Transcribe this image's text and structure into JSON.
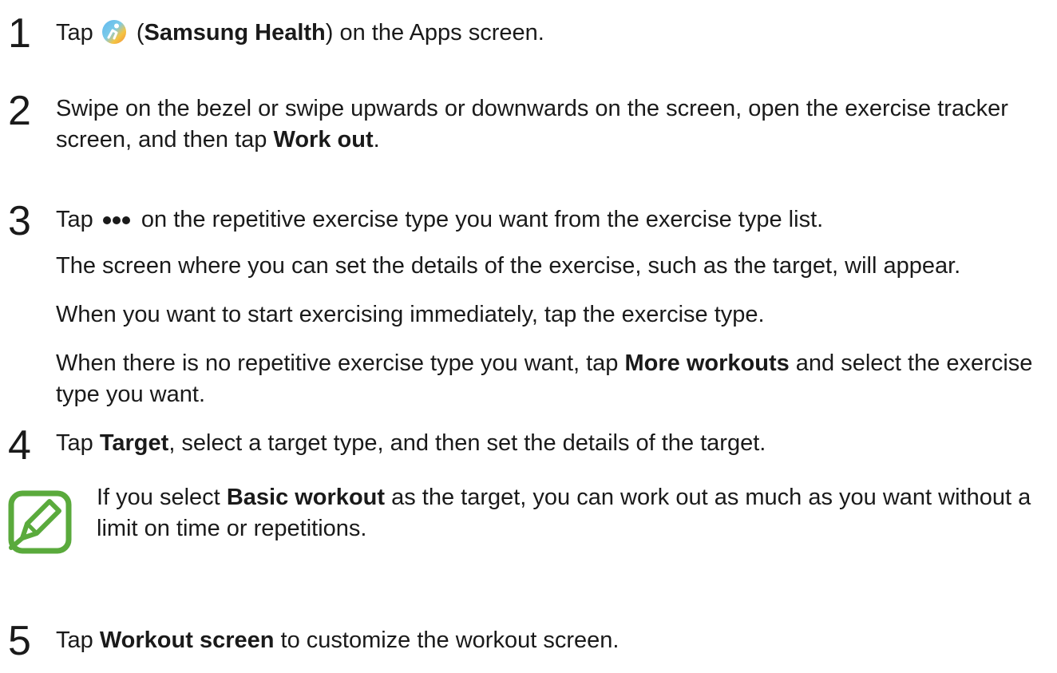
{
  "steps": [
    {
      "number": "1",
      "pre": "Tap ",
      "icon": "samsung-health-app-icon",
      "open_paren": " (",
      "bold": "Samsung Health",
      "post": ") on the Apps screen."
    },
    {
      "number": "2",
      "pre": "Swipe on the bezel or swipe upwards or downwards on the screen, open the exercise tracker screen, and then tap ",
      "bold": "Work out",
      "post": "."
    },
    {
      "number": "3",
      "pre": "Tap ",
      "icon": "more-options-icon",
      "post": " on the repetitive exercise type you want from the exercise type list.",
      "line2": "The screen where you can set the details of the exercise, such as the target, will appear.",
      "line3": "When you want to start exercising immediately, tap the exercise type.",
      "line4_pre": "When there is no repetitive exercise type you want, tap ",
      "line4_bold": "More workouts",
      "line4_post": " and select the exercise type you want."
    },
    {
      "number": "4",
      "pre": "Tap ",
      "bold": "Target",
      "post": ", select a target type, and then set the details of the target."
    },
    {
      "number": "5",
      "pre": "Tap ",
      "bold": "Workout screen",
      "post": " to customize the workout screen."
    }
  ],
  "note": {
    "icon": "note-pencil-icon",
    "pre": "If you select ",
    "bold": "Basic workout",
    "post": " as the target, you can work out as much as you want without a limit on time or repetitions."
  },
  "colors": {
    "text": "#1a1a1a",
    "note_icon": "#5aaa3c"
  }
}
